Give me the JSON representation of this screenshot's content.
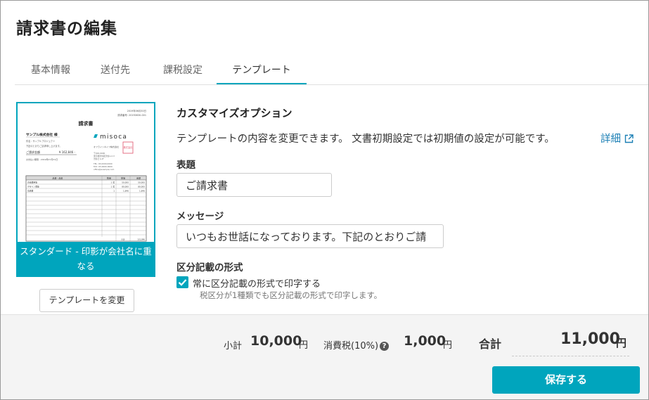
{
  "page": {
    "title": "請求書の編集"
  },
  "tabs": [
    {
      "label": "基本情報"
    },
    {
      "label": "送付先"
    },
    {
      "label": "課税設定"
    },
    {
      "label": "テンプレート"
    }
  ],
  "template": {
    "caption_line1": "スタンダード - 印影が会社名に重",
    "caption_line2": "なる",
    "change_button": "テンプレートを変更",
    "thumbnail": {
      "meta_line1": "2019年06月30日",
      "meta_line2": "請求番号: 20190630-001",
      "doc_title": "請求書",
      "customer": "サンプル株式会社 様",
      "subject": "件名 : サンプルプロジェクト",
      "note": "下記のとおりご請求申し上げます。",
      "total_label": "ご請求金額",
      "total_value": "¥ 162,846 -",
      "due": "お支払い期限 : 2019年07月31日",
      "brand": "misoca",
      "sender": "オフラインネイフ株式会社",
      "stamp": "株式会社",
      "address1": "〒000-0000",
      "address2": "東京都渋谷区渋谷1-2-3",
      "address3": "渋谷ビル1F",
      "tel": "TEL: 03-0000-0000",
      "fax": "FAX: 03-0000-0000",
      "email": "office@example.com",
      "col1": "品番・品名",
      "col2": "数量",
      "col3": "単価",
      "col4": "金額",
      "rows": [
        {
          "name": "企画費用等",
          "qty": "1 式",
          "price": "50,000",
          "amount": "50,000"
        },
        {
          "name": "デザイン費等",
          "qty": "1 式",
          "price": "80,000",
          "amount": "80,000"
        },
        {
          "name": "交通費",
          "qty": "1",
          "price": "1,846",
          "amount": "1,846"
        }
      ],
      "subtotal_label": "小計",
      "subtotal_value": "131,846"
    }
  },
  "customize": {
    "title": "カスタマイズオプション",
    "description": "テンプレートの内容を変更できます。 文書初期設定では初期値の設定が可能です。",
    "detail_link": "詳細",
    "subject_label": "表題",
    "subject_value": "ご請求書",
    "message_label": "メッセージ",
    "message_value": "いつもお世話になっております。下記のとおりご請",
    "format_label": "区分記載の形式",
    "checkbox_label": "常に区分記載の形式で印字する",
    "checkbox_checked": true,
    "hint": "税区分が1種類でも区分記載の形式で印字します。"
  },
  "totals": {
    "subtotal_label": "小計",
    "subtotal_value": "10,000",
    "currency": "円",
    "tax_label": "消費税(10%)",
    "tax_help_icon": "question-circle-icon",
    "tax_value": "1,000",
    "total_label": "合計",
    "total_value": "11,000"
  },
  "actions": {
    "save": "保存する"
  },
  "colors": {
    "accent": "#00a5bd",
    "link": "#1b7fb5"
  }
}
